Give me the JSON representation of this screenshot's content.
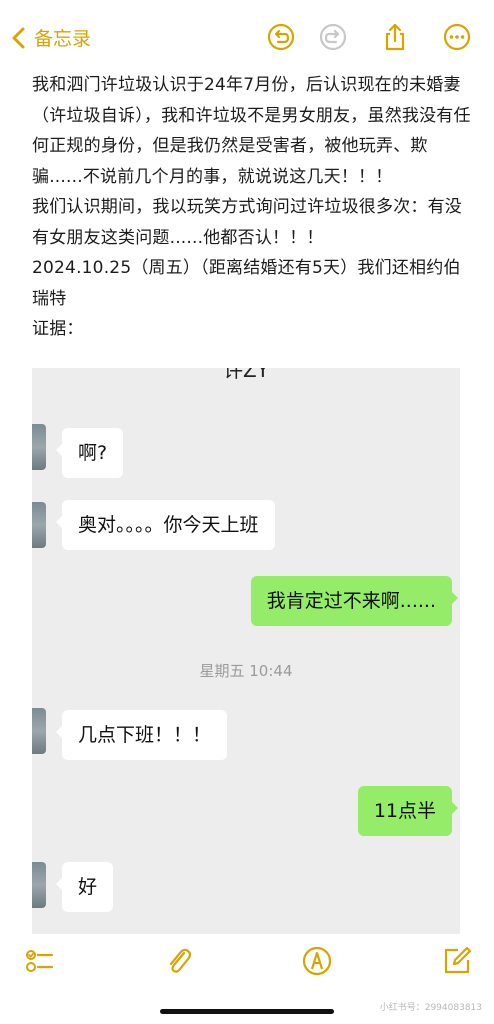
{
  "nav": {
    "back_label": "备忘录",
    "accent": "#d9a400"
  },
  "note": {
    "paragraphs": [
      "我和泗门许垃圾认识于24年7月份，后认识现在的未婚妻（许垃圾自诉），我和许垃圾不是男女朋友，虽然我没有任何正规的身份，但是我仍然是受害者，被他玩弄、欺骗......不说前几个月的事，就说说这几天！！！",
      "我们认识期间，我以玩笑方式询问过许垃圾很多次：有没有女朋友这类问题......他都否认！！！",
      "2024.10.25（周五）（距离结婚还有5天）我们还相约伯瑞特",
      "证据："
    ]
  },
  "chat": {
    "title": "许ZY",
    "timestamp": "星期五 10:44",
    "messages": [
      {
        "side": "left",
        "text": "啊?"
      },
      {
        "side": "left",
        "text": "奥对。。。。你今天上班"
      },
      {
        "side": "right",
        "text": "我肯定过不来啊......"
      },
      {
        "side": "left",
        "text": "几点下班！！！"
      },
      {
        "side": "right",
        "text": "11点半"
      },
      {
        "side": "left",
        "text": "好"
      }
    ],
    "bubble_color_right": "#95ec69",
    "bubble_color_left": "#ffffff"
  },
  "toolbar": {
    "icons": [
      "checklist-icon",
      "attachment-icon",
      "markup-icon",
      "compose-icon"
    ]
  },
  "watermark": "小红书号：2994083813"
}
